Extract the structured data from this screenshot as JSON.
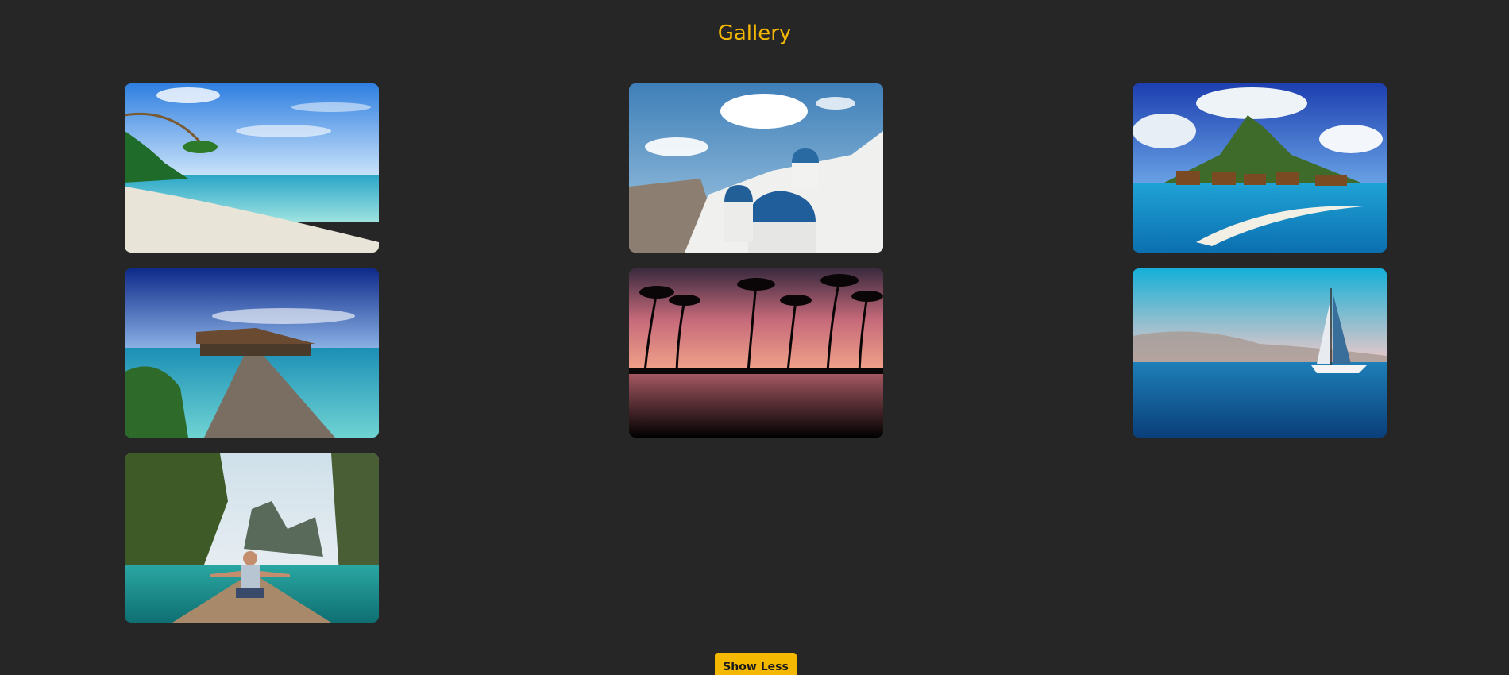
{
  "page": {
    "title": "Gallery",
    "background": "#262626",
    "accent": "#f5b800"
  },
  "gallery": {
    "images": [
      {
        "name": "tropical-beach-photo"
      },
      {
        "name": "santorini-domes-photo"
      },
      {
        "name": "bora-bora-bungalows-photo"
      },
      {
        "name": "overwater-pier-photo"
      },
      {
        "name": "palm-sunset-photo"
      },
      {
        "name": "sailboat-sea-photo"
      },
      {
        "name": "boat-traveler-photo"
      }
    ]
  },
  "actions": {
    "toggle_label": "Show Less"
  }
}
